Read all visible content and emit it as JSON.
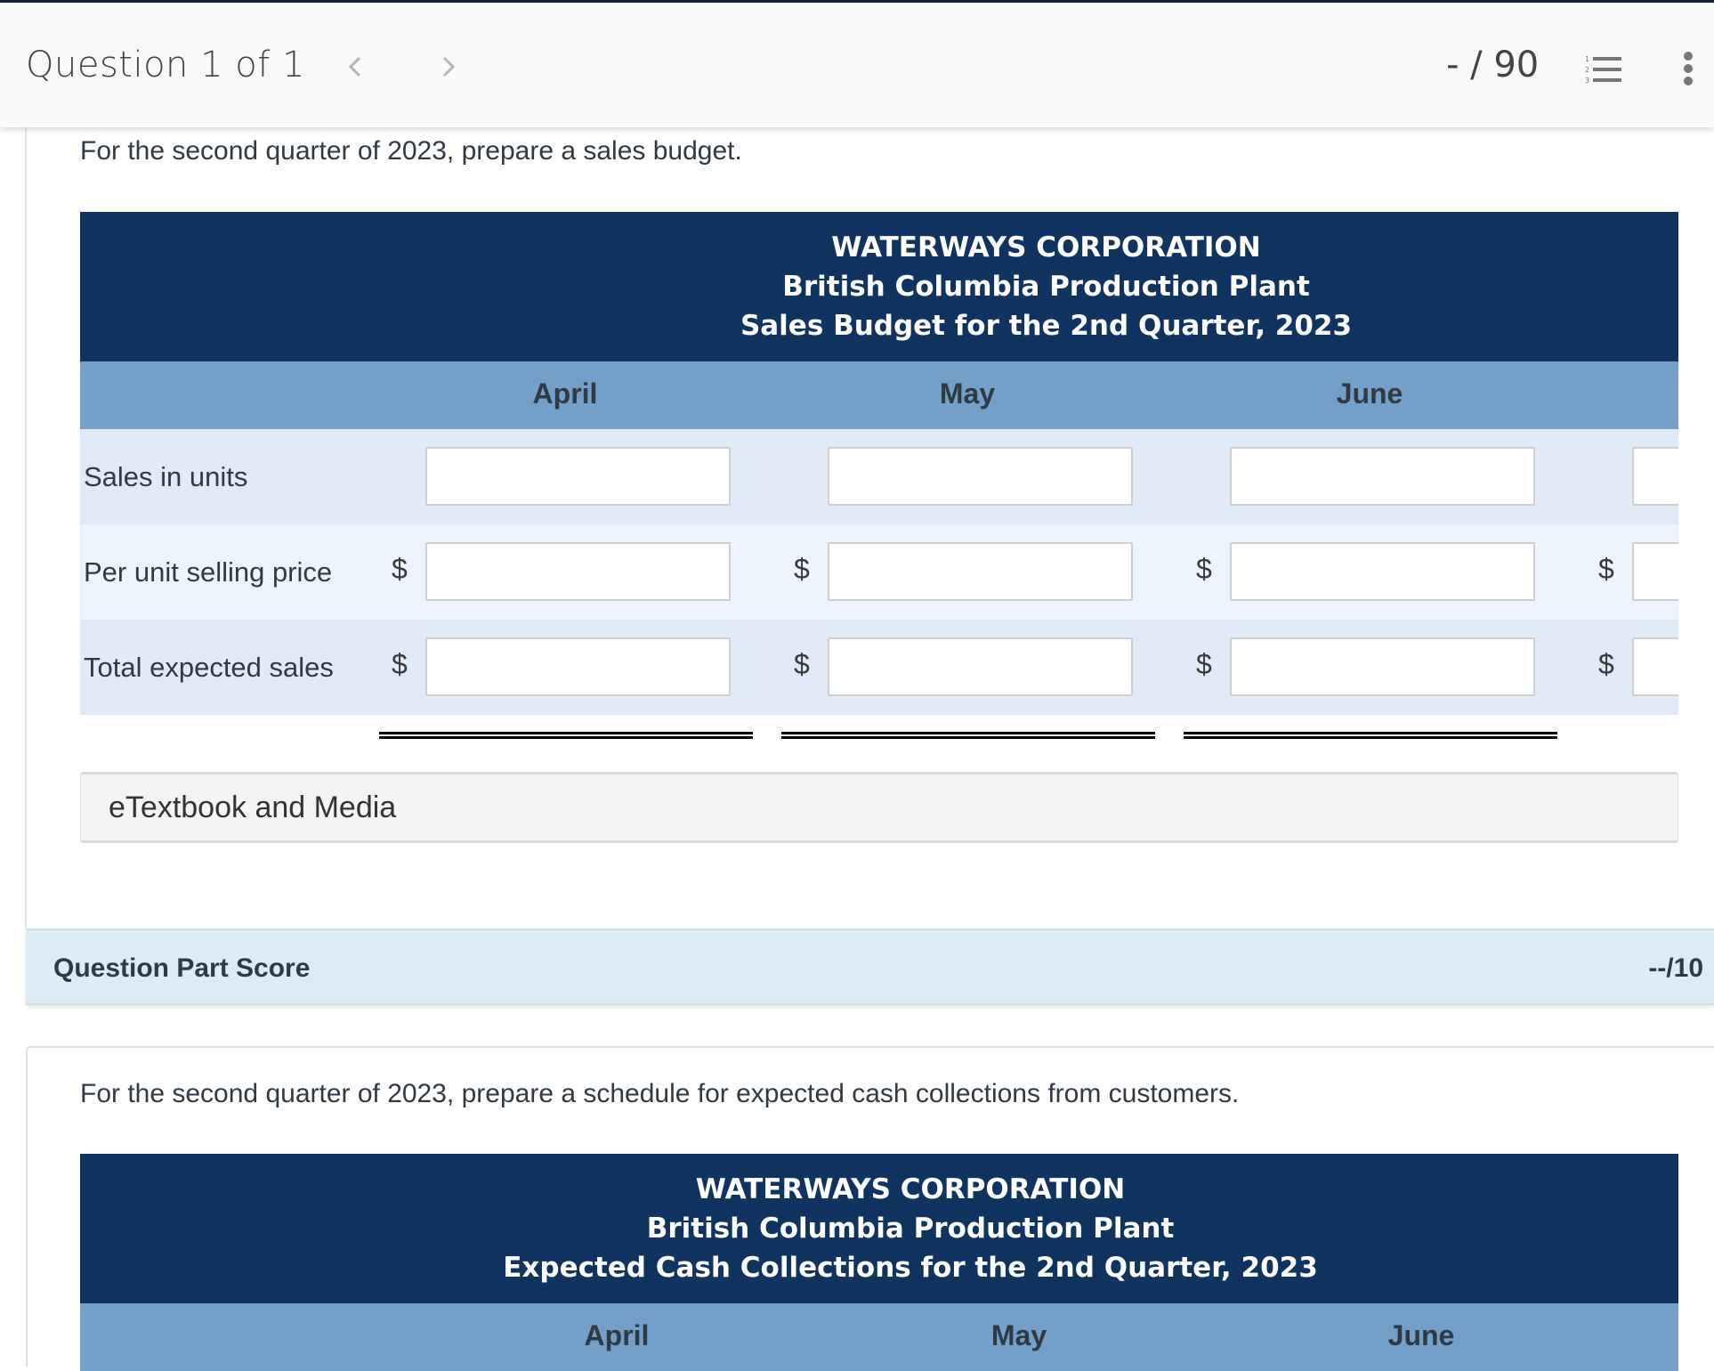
{
  "header": {
    "question_counter": "Question 1 of 1",
    "prev_icon": "chevron-left-icon",
    "next_icon": "chevron-right-icon",
    "score": "- / 90",
    "list_icon": "numbered-list-icon",
    "more_icon": "more-vertical-icon"
  },
  "part1": {
    "prompt": "For the second quarter of 2023, prepare a sales budget.",
    "table": {
      "title_lines": [
        "WATERWAYS CORPORATION",
        "British Columbia Production Plant",
        "Sales Budget for the 2nd Quarter, 2023"
      ],
      "columns": [
        "April",
        "May",
        "June"
      ],
      "rows": [
        {
          "label": "Sales in units",
          "currency": [
            "",
            "",
            "",
            ""
          ],
          "values": [
            "",
            "",
            "",
            ""
          ]
        },
        {
          "label": "Per unit selling price",
          "currency": [
            "$",
            "$",
            "$",
            "$"
          ],
          "values": [
            "",
            "",
            "",
            ""
          ]
        },
        {
          "label": "Total expected sales",
          "currency": [
            "$",
            "$",
            "$",
            "$"
          ],
          "values": [
            "",
            "",
            "",
            ""
          ]
        }
      ]
    },
    "etextbook_label": "eTextbook and Media",
    "score_label": "Question Part Score",
    "score_value": "--/10"
  },
  "part2": {
    "prompt": "For the second quarter of 2023, prepare a schedule for expected cash collections from customers.",
    "table": {
      "title_lines": [
        "WATERWAYS CORPORATION",
        "British Columbia Production Plant",
        "Expected Cash Collections for the 2nd Quarter, 2023"
      ],
      "columns": [
        "April",
        "May",
        "June"
      ]
    }
  }
}
